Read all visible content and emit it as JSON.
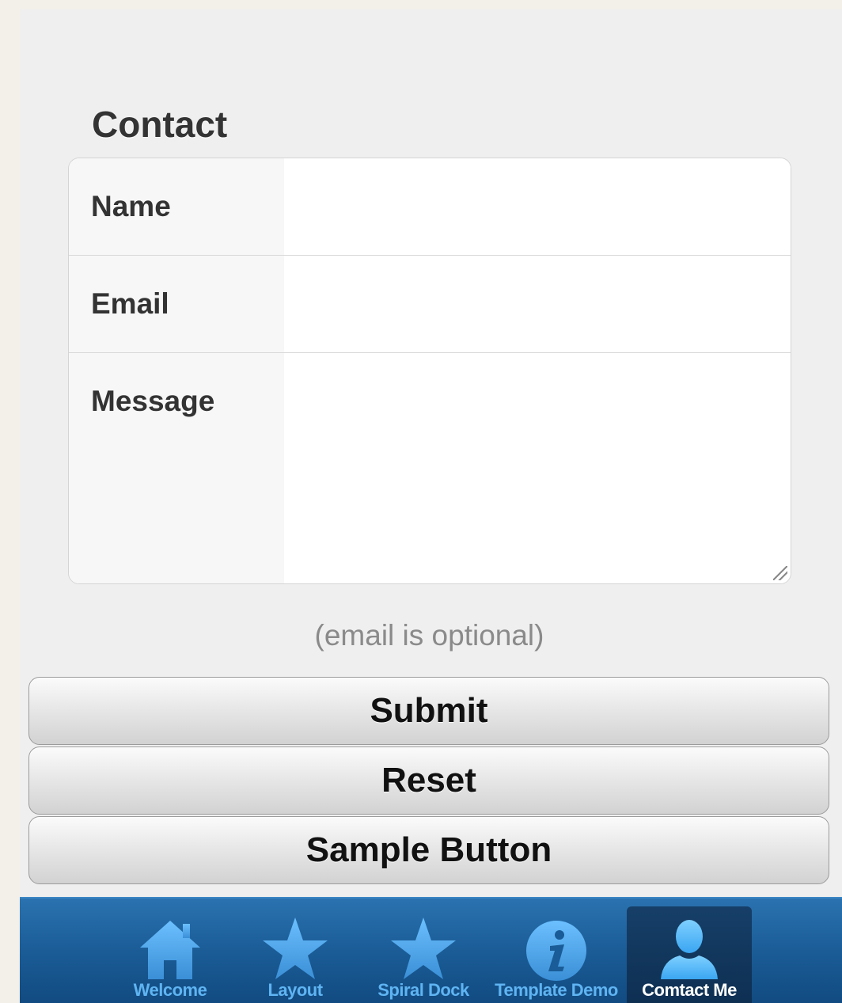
{
  "form": {
    "title": "Contact",
    "fields": {
      "name": {
        "label": "Name",
        "value": "",
        "placeholder": ""
      },
      "email": {
        "label": "Email",
        "value": "",
        "placeholder": ""
      },
      "message": {
        "label": "Message",
        "value": "",
        "placeholder": ""
      }
    },
    "hint": "(email is optional)"
  },
  "buttons": {
    "submit": "Submit",
    "reset": "Reset",
    "sample": "Sample Button"
  },
  "tabbar": {
    "active": "contact",
    "tabs": [
      {
        "id": "welcome",
        "label": "Welcome",
        "icon": "home-icon"
      },
      {
        "id": "layout",
        "label": "Layout",
        "icon": "star-icon"
      },
      {
        "id": "spiral",
        "label": "Spiral Dock",
        "icon": "star-icon"
      },
      {
        "id": "template",
        "label": "Template Demo",
        "icon": "info-icon"
      },
      {
        "id": "contact",
        "label": "Comtact Me",
        "icon": "user-icon"
      }
    ]
  },
  "colors": {
    "tab_icon": "#4aa6ee",
    "tab_icon_active": "#5cc0ff",
    "tabbar": "#1c5e99"
  }
}
